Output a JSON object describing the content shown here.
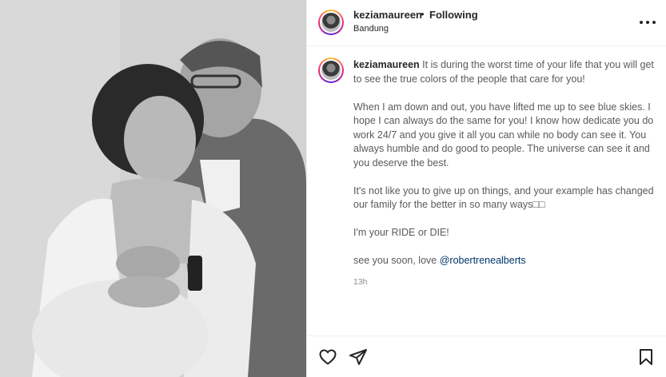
{
  "post": {
    "author": "keziamaureen",
    "separator": "•",
    "follow_status": "Following",
    "location": "Bandung"
  },
  "caption": {
    "author": "keziamaureen",
    "p1": "It is during the worst time of your life that you will get to see the true colors of the people that care for you!",
    "p2": "When I am down and out, you have lifted me up to see blue skies. I hope I can always do the same for you! I know how dedicate you do work 24/7 and you give it all you can while no body can see it. You always humble and do good to people. The universe can see it and you deserve the best.",
    "p3": "It's not like you to give up on things, and your example has changed our family for the better in so many ways□□",
    "p4": "I'm your RIDE or DIE!",
    "p5_prefix": "see you soon, love ",
    "mention": "@robertrenealberts",
    "time": "13h"
  },
  "icons": {
    "more": "more-horizontal-icon",
    "like": "heart-icon",
    "share": "paper-plane-icon",
    "save": "bookmark-icon"
  }
}
